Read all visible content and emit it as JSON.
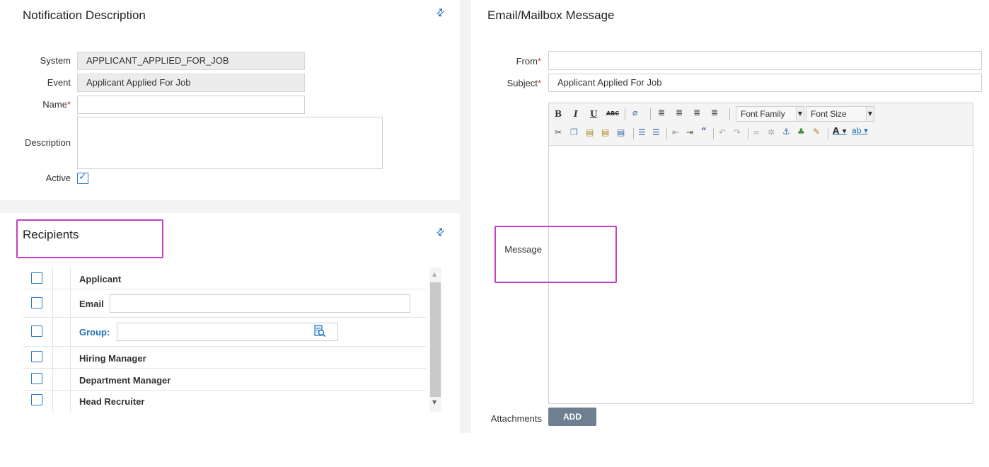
{
  "notification": {
    "title": "Notification Description",
    "system_label": "System",
    "system_value": "APPLICANT_APPLIED_FOR_JOB",
    "event_label": "Event",
    "event_value": "Applicant Applied For Job",
    "name_label": "Name",
    "name_required": "*",
    "name_value": "",
    "description_label": "Description",
    "description_value": "",
    "active_label": "Active",
    "active_checked": true
  },
  "recipients": {
    "title": "Recipients",
    "items": [
      {
        "label": "Applicant",
        "checked": false
      },
      {
        "label": "Email",
        "checked": false,
        "input_value": ""
      },
      {
        "label": "Group:",
        "checked": false,
        "input_value": ""
      },
      {
        "label": "Hiring Manager",
        "checked": false
      },
      {
        "label": "Department Manager",
        "checked": false
      },
      {
        "label": "Head Recruiter",
        "checked": false
      }
    ],
    "group_color": "#1f6fb5"
  },
  "email": {
    "title": "Email/Mailbox Message",
    "from_label": "From",
    "from_required": "*",
    "from_value": "",
    "subject_label": "Subject",
    "subject_required": "*",
    "subject_value": "Applicant Applied For Job",
    "font_family_label": "Font Family",
    "font_size_label": "Font Size",
    "message_label": "Message",
    "message_value": "",
    "attachments_label": "Attachments",
    "add_button": "ADD"
  },
  "colors": {
    "accent": "#1f6fb5",
    "required": "#c0392b",
    "highlight": "#c43fc4",
    "add_button": "#6d7f91"
  }
}
